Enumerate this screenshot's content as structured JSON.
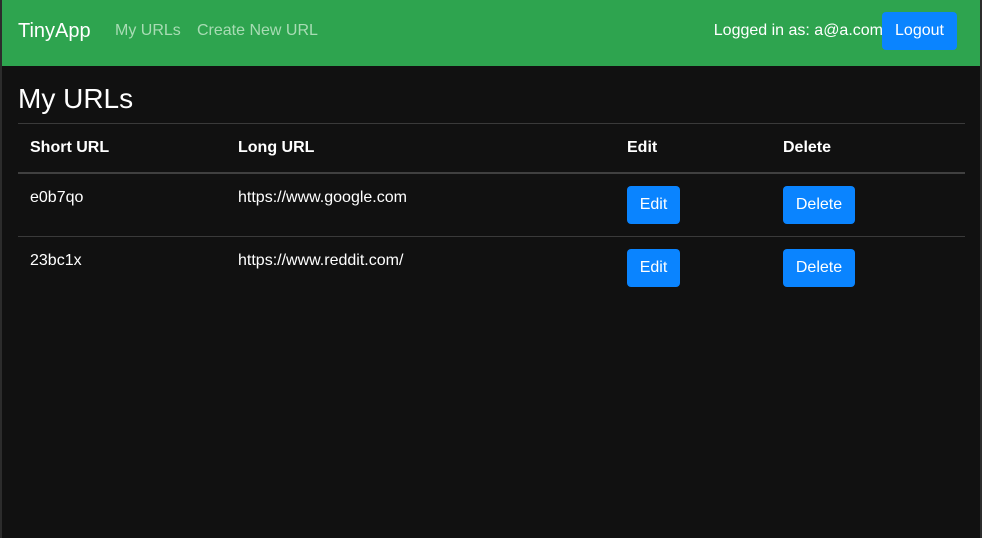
{
  "navbar": {
    "brand": "TinyApp",
    "links": [
      {
        "label": "My URLs"
      },
      {
        "label": "Create New URL"
      }
    ],
    "user_status": "Logged in as: a@a.com",
    "logout_label": "Logout"
  },
  "page": {
    "title": "My URLs"
  },
  "table": {
    "headers": [
      "Short URL",
      "Long URL",
      "Edit",
      "Delete"
    ],
    "rows": [
      {
        "short_url": "e0b7qo",
        "long_url": "https://www.google.com",
        "edit_label": "Edit",
        "delete_label": "Delete"
      },
      {
        "short_url": "23bc1x",
        "long_url": "https://www.reddit.com/",
        "edit_label": "Edit",
        "delete_label": "Delete"
      }
    ]
  },
  "colors": {
    "navbar": "#2ea44f",
    "button": "#0a84ff",
    "background": "#111111"
  }
}
